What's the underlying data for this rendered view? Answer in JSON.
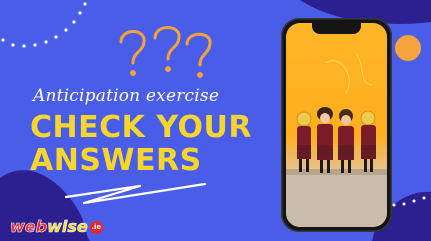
{
  "slide": {
    "subtitle": "Anticipation exercise",
    "headline_line1": "CHECK YOUR",
    "headline_line2": "ANSWERS",
    "decoration": "question-marks",
    "photo": "students-in-uniform-holding-cutout-faces"
  },
  "brand": {
    "name_part1": "web",
    "name_part2": "wise",
    "suffix": ".ie"
  },
  "colors": {
    "background": "#4a5de8",
    "blob_dark": "#2c1f8f",
    "accent_yellow": "#f6d62c",
    "accent_orange": "#f4a23b",
    "phone_body": "#151515"
  }
}
